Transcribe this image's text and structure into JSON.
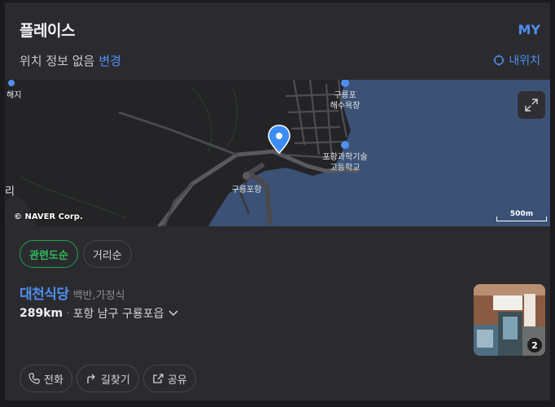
{
  "header": {
    "title": "플레이스",
    "my_label": "MY"
  },
  "location": {
    "status": "위치 정보 없음",
    "change_label": "변경",
    "my_location_label": "내위치"
  },
  "map": {
    "labels": {
      "beach_line1": "구룡포",
      "beach_line2": "해수욕장",
      "school_line1": "포항과학기술",
      "school_line2": "고등학교",
      "port": "구룡포항",
      "left_edge_top": "해지",
      "left_edge_mid": "리"
    },
    "copyright": "© NAVER Corp.",
    "scale": "500m"
  },
  "sort": {
    "options": [
      "관련도순",
      "거리순"
    ],
    "selected": "관련도순"
  },
  "result": {
    "name": "대천식당",
    "category": "백반,가정식",
    "distance": "289km",
    "address": "포항 남구 구룡포읍",
    "photo_count": "2"
  },
  "actions": {
    "call": "전화",
    "directions": "길찾기",
    "share": "공유"
  },
  "colors": {
    "accent": "#4f8ff0",
    "active_green": "#2dbe5a",
    "water": "#3b5276"
  }
}
